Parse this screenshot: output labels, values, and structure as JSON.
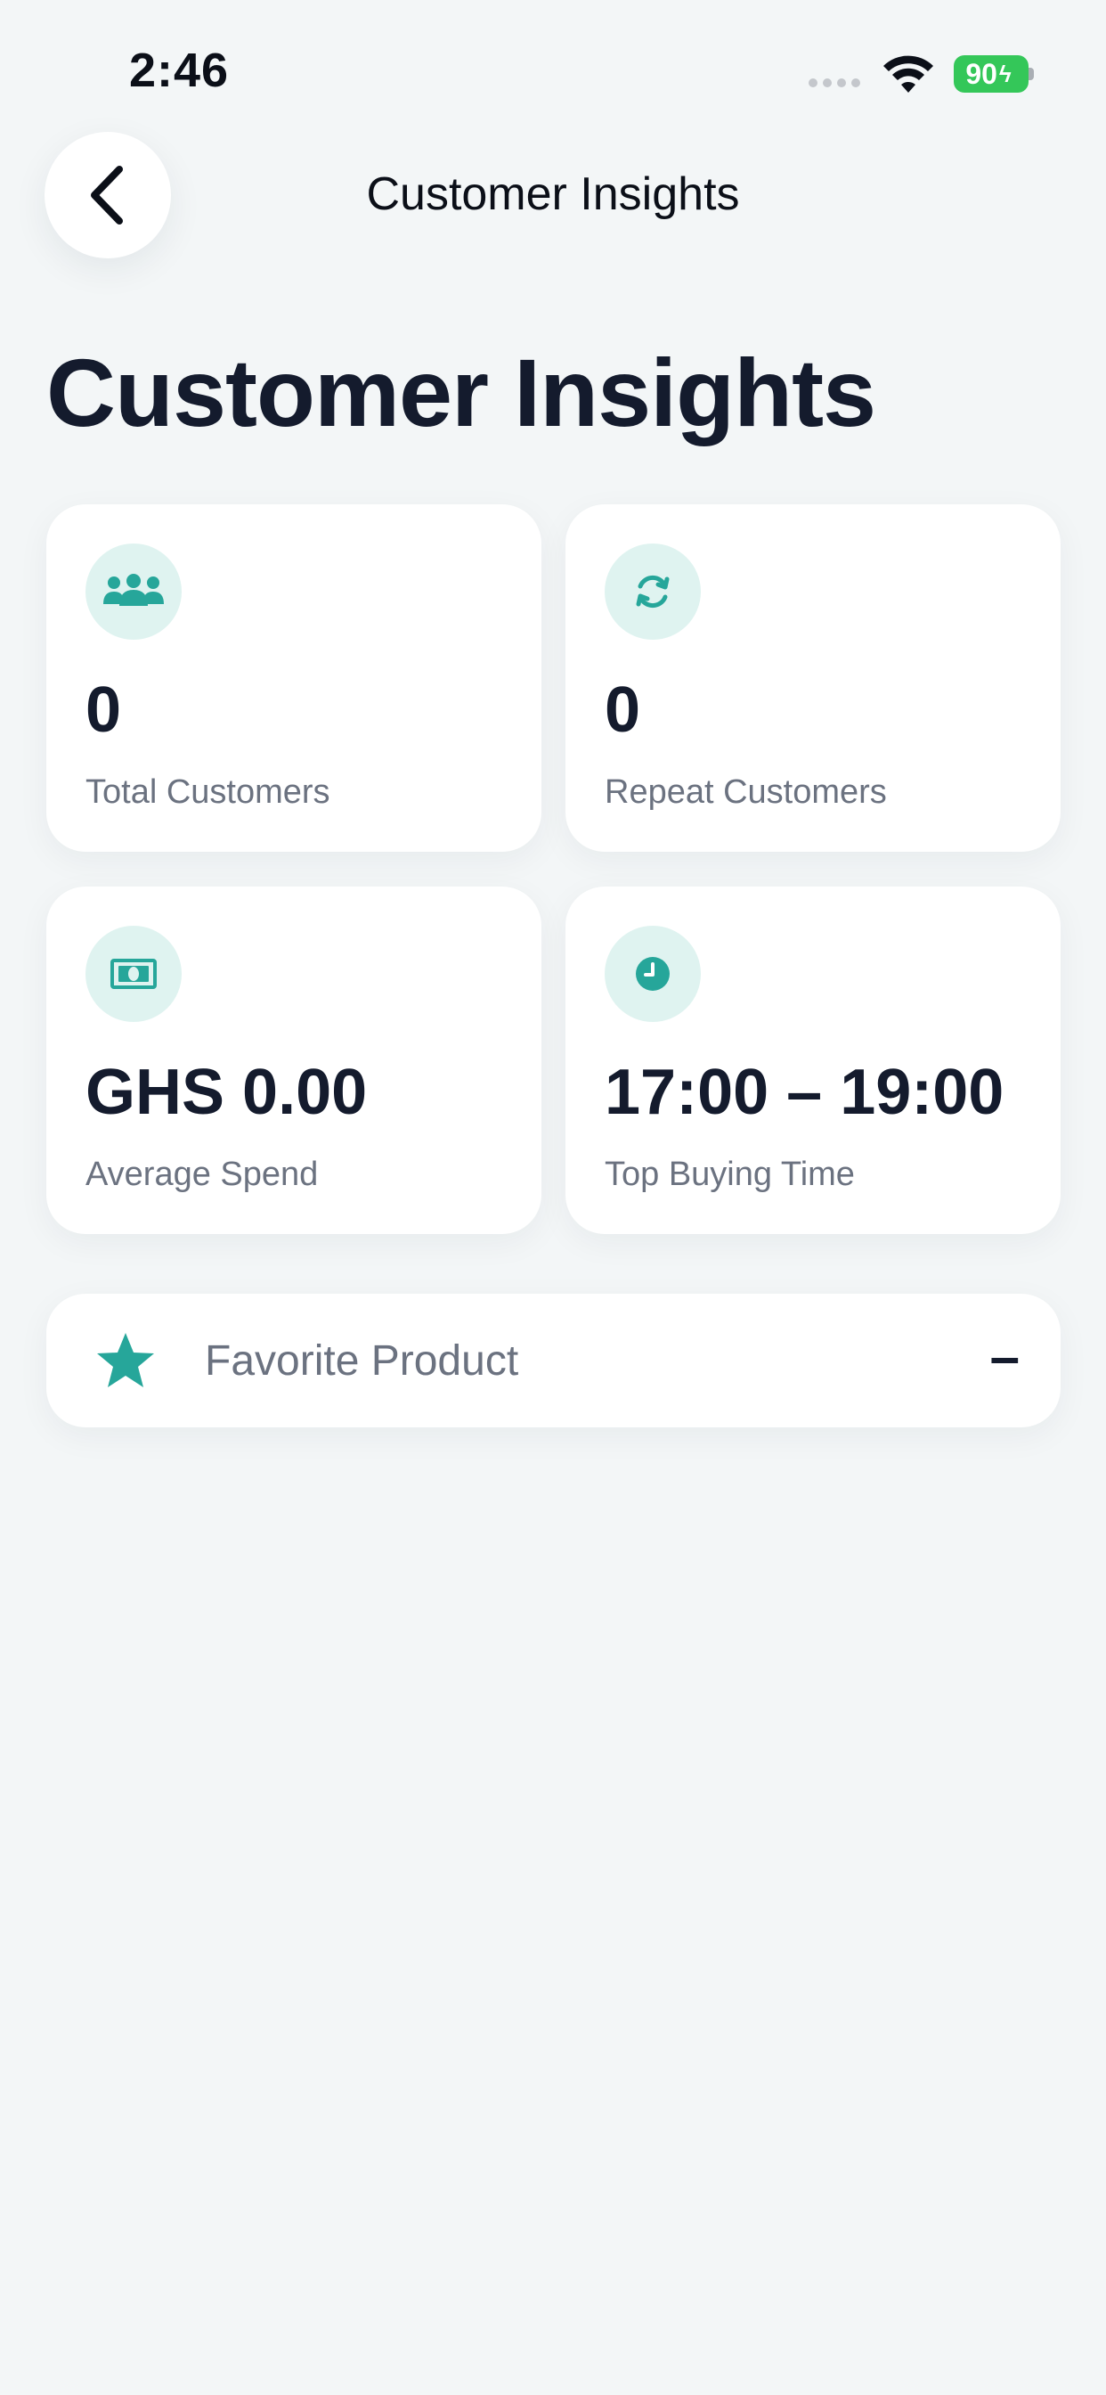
{
  "status_bar": {
    "time": "2:46",
    "battery": "90"
  },
  "header": {
    "title": "Customer Insights"
  },
  "page": {
    "title": "Customer Insights"
  },
  "metrics": {
    "total_customers": {
      "value": "0",
      "label": "Total Customers",
      "icon": "users-icon"
    },
    "repeat_customers": {
      "value": "0",
      "label": "Repeat Customers",
      "icon": "refresh-icon"
    },
    "average_spend": {
      "value": "GHS 0.00",
      "label": "Average Spend",
      "icon": "cash-icon"
    },
    "top_buying_time": {
      "value": "17:00 – 19:00",
      "label": "Top Buying Time",
      "icon": "clock-icon"
    }
  },
  "favorite_product": {
    "label": "Favorite Product",
    "value": "–",
    "icon": "star-icon"
  },
  "colors": {
    "accent": "#26a69a",
    "accent_bg": "#dff3f0",
    "background": "#f3f6f7",
    "text_primary": "#141b2d",
    "text_secondary": "#6b7280",
    "battery": "#34c759"
  }
}
